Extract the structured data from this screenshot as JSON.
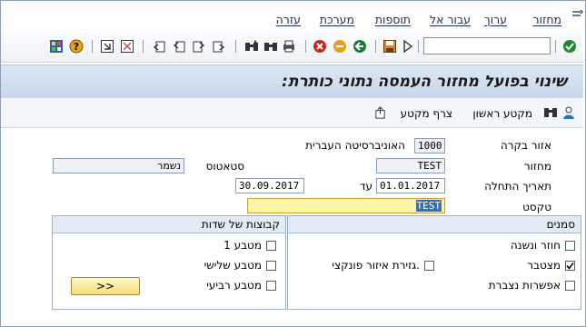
{
  "menu": {
    "items": [
      "מחזור",
      "ערוך",
      "עבור אל",
      "תוספות",
      "מערכת",
      "עזרה"
    ]
  },
  "toolbar": {
    "command_field_value": "",
    "icons": [
      "check-icon",
      "save-icon",
      "back-icon",
      "exit-icon",
      "cancel-icon",
      "print-icon",
      "find-icon",
      "find-next-icon",
      "first-page-icon",
      "prev-page-icon",
      "next-page-icon",
      "last-page-icon",
      "new-session-icon",
      "shortcut-icon",
      "help-icon",
      "layout-icon"
    ]
  },
  "title": "שינוי בפועל מחזור העמסה נתוני כותרת:",
  "app_toolbar": {
    "attach_label": "צרף מקטע",
    "first_label": "מקטע ראשון"
  },
  "form": {
    "area_label": "אזור בקרה",
    "area_value": "1000",
    "area_desc": "האוניברסיטה העברית",
    "cycle_label": "מחזור",
    "cycle_value": "TEST",
    "status_label": "סטאטוס",
    "status_value": "נשמר",
    "start_label": "תאריך התחלה",
    "start_value": "01.01.2017",
    "to_label": "עד",
    "end_value": "30.09.2017",
    "text_label": "טקסט",
    "text_value": "TEST"
  },
  "flags_group": {
    "title": "סמנים",
    "items": [
      {
        "label": "חוזר ונשנה",
        "checked": false
      },
      {
        "label": "מצטבר",
        "checked": true
      },
      {
        "label": "אפשרות נצברת",
        "checked": false
      },
      {
        "label": "גזירת איזור פונקצי.",
        "checked": false
      }
    ]
  },
  "fieldgroups": {
    "title": "קבוצות של שדות",
    "items": [
      {
        "label": "מטבע 1",
        "checked": false
      },
      {
        "label": "מטבע שלישי",
        "checked": false
      },
      {
        "label": "מטבע רביעי",
        "checked": false
      }
    ],
    "button_label": ">>"
  }
}
